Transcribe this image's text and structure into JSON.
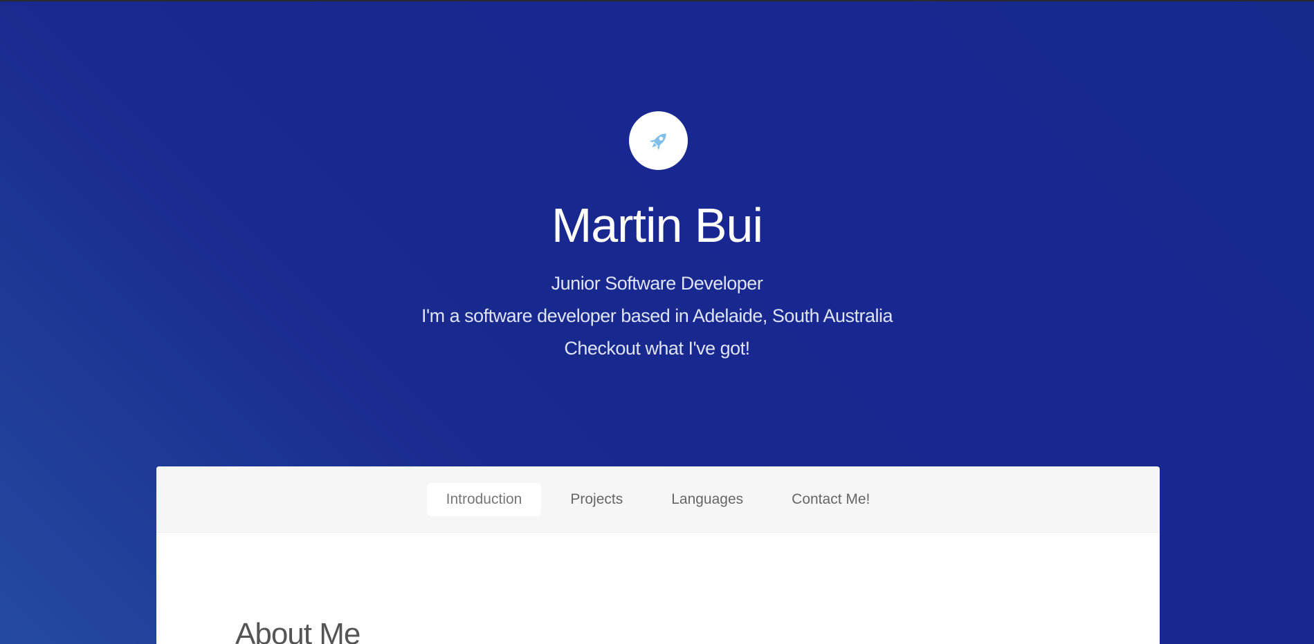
{
  "header": {
    "logo_icon": "rocket-icon",
    "name": "Martin Bui",
    "role": "Junior Software Developer",
    "bio": "I'm a software developer based in Adelaide, South Australia",
    "cta": "Checkout what I've got!"
  },
  "nav": {
    "items": [
      {
        "label": "Introduction",
        "active": true
      },
      {
        "label": "Projects",
        "active": false
      },
      {
        "label": "Languages",
        "active": false
      },
      {
        "label": "Contact Me!",
        "active": false
      }
    ]
  },
  "main": {
    "section_title": "About Me"
  },
  "colors": {
    "background": "#19298d",
    "accent": "#7fbfe8",
    "card": "#ffffff",
    "nav_bg": "#f6f6f6"
  }
}
